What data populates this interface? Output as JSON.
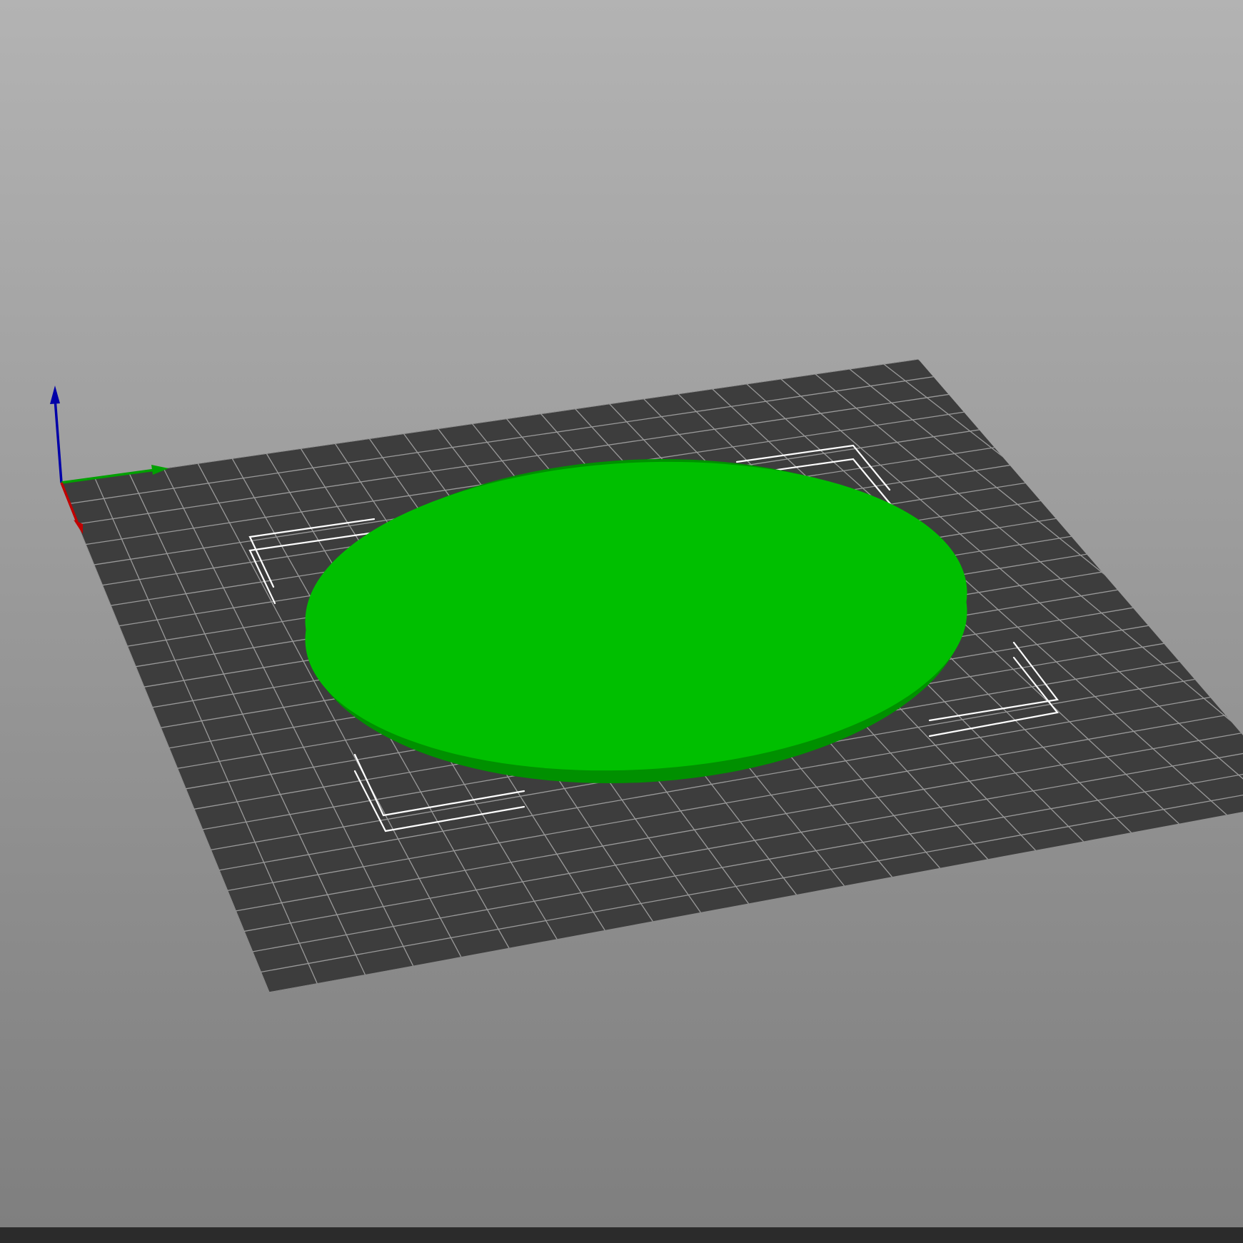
{
  "viewport": {
    "background_top": "#b3b3b3",
    "background_bottom": "#7f7f7f"
  },
  "bed": {
    "surface_color": "#3d3d3d",
    "grid_color": "#9a9a9a",
    "grid_divisions": 25
  },
  "object": {
    "shape": "cylinder-disc",
    "top_color": "#00bf00",
    "side_color": "#009a00",
    "state": "selected"
  },
  "bounding_box": {
    "corner_color": "#ffffff"
  },
  "axes": {
    "x_color": "#c00000",
    "y_color": "#00a000",
    "z_color": "#0000a8"
  },
  "status_bar": {
    "color": "#2b2b2b"
  }
}
